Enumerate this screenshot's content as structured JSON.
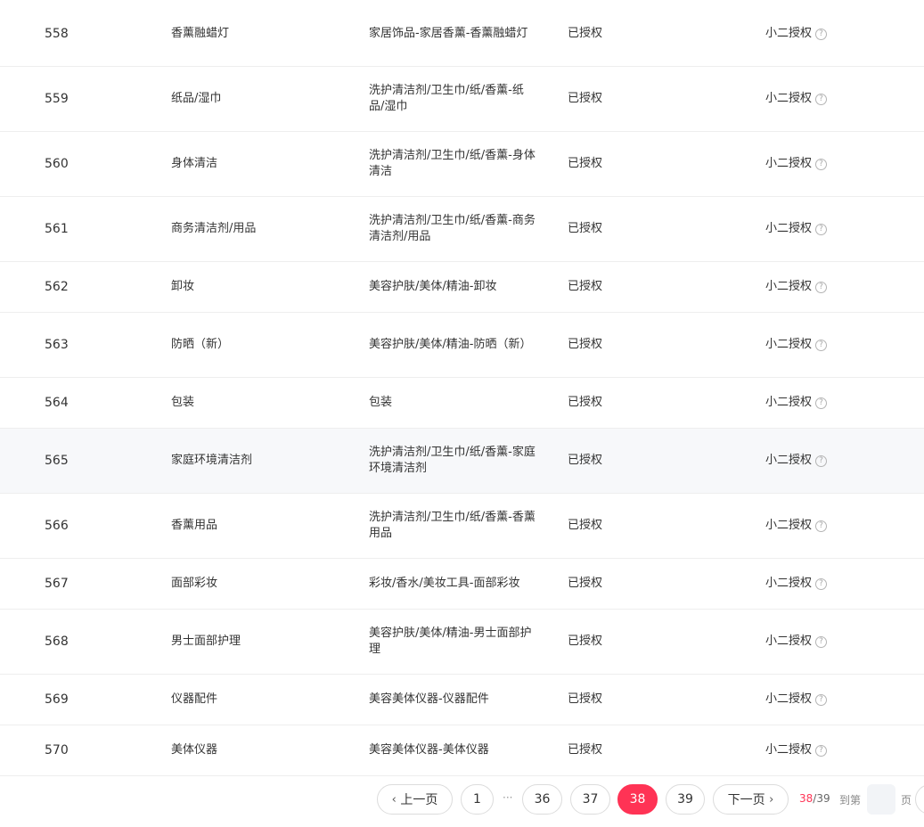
{
  "table": {
    "rows": [
      {
        "id": "558",
        "name": "香薰融蜡灯",
        "path": "家居饰品-家居香薰-香薰融蜡灯",
        "status": "已授权",
        "auth": "小二授权"
      },
      {
        "id": "559",
        "name": "纸品/湿巾",
        "path": "洗护清洁剂/卫生巾/纸/香薰-纸品/湿巾",
        "status": "已授权",
        "auth": "小二授权"
      },
      {
        "id": "560",
        "name": "身体清洁",
        "path": "洗护清洁剂/卫生巾/纸/香薰-身体清洁",
        "status": "已授权",
        "auth": "小二授权"
      },
      {
        "id": "561",
        "name": "商务清洁剂/用品",
        "path": "洗护清洁剂/卫生巾/纸/香薰-商务清洁剂/用品",
        "status": "已授权",
        "auth": "小二授权"
      },
      {
        "id": "562",
        "name": "卸妆",
        "path": "美容护肤/美体/精油-卸妆",
        "status": "已授权",
        "auth": "小二授权"
      },
      {
        "id": "563",
        "name": "防晒（新）",
        "path": "美容护肤/美体/精油-防晒（新）",
        "status": "已授权",
        "auth": "小二授权"
      },
      {
        "id": "564",
        "name": "包装",
        "path": "包装",
        "status": "已授权",
        "auth": "小二授权"
      },
      {
        "id": "565",
        "name": "家庭环境清洁剂",
        "path": "洗护清洁剂/卫生巾/纸/香薰-家庭环境清洁剂",
        "status": "已授权",
        "auth": "小二授权"
      },
      {
        "id": "566",
        "name": "香薰用品",
        "path": "洗护清洁剂/卫生巾/纸/香薰-香薰用品",
        "status": "已授权",
        "auth": "小二授权"
      },
      {
        "id": "567",
        "name": "面部彩妆",
        "path": "彩妆/香水/美妆工具-面部彩妆",
        "status": "已授权",
        "auth": "小二授权"
      },
      {
        "id": "568",
        "name": "男士面部护理",
        "path": "美容护肤/美体/精油-男士面部护理",
        "status": "已授权",
        "auth": "小二授权"
      },
      {
        "id": "569",
        "name": "仪器配件",
        "path": "美容美体仪器-仪器配件",
        "status": "已授权",
        "auth": "小二授权"
      },
      {
        "id": "570",
        "name": "美体仪器",
        "path": "美容美体仪器-美体仪器",
        "status": "已授权",
        "auth": "小二授权"
      }
    ],
    "help_icon": "question-circle-icon",
    "help_glyph": "?"
  },
  "pagination": {
    "prev_label": "上一页",
    "next_label": "下一页",
    "first_page": "1",
    "ellipsis": "···",
    "pages": [
      "36",
      "37",
      "38",
      "39"
    ],
    "current_page": "38",
    "total_pages": "39",
    "separator": "/",
    "goto_label": "到第",
    "page_label": "页",
    "goto_value": "",
    "active_color": "#ff3355"
  }
}
